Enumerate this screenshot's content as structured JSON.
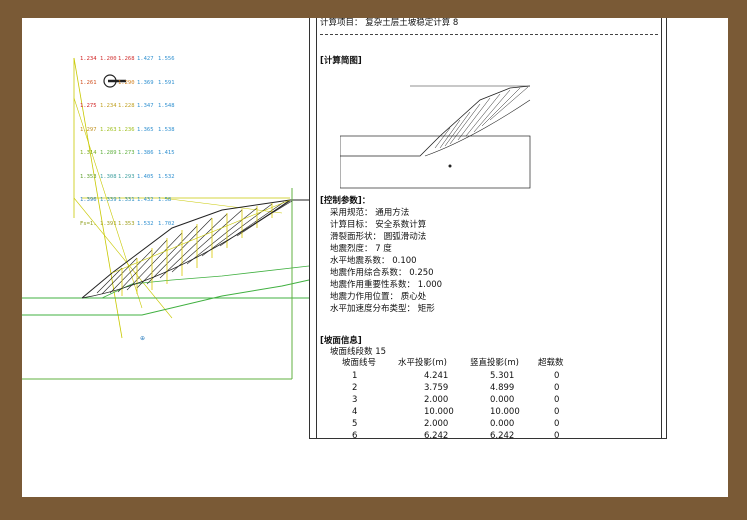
{
  "report": {
    "project_title": "计算项目：  复杂土层土坡稳定计算  8",
    "section_diagram": "[计算简图]",
    "section_control": "[控制参数]：",
    "params": [
      "采用规范：  通用方法",
      "计算目标：  安全系数计算",
      "滑裂面形状：  圆弧滑动法",
      "地震烈度：  7 度",
      "水平地震系数：  0.100",
      "地震作用综合系数：    0.250",
      "地震作用重要性系数：  1.000",
      "地震力作用位置：  质心处",
      "水平加速度分布类型：  矩形"
    ],
    "section_slope": "[坡面信息]",
    "slope_segments": "坡面线段数  15",
    "table_headers": [
      "坡面线号",
      "水平投影(m)",
      "竖直投影(m)",
      "超载数"
    ],
    "table_rows": [
      [
        "1",
        "4.241",
        "5.301",
        "0"
      ],
      [
        "2",
        "3.759",
        "4.899",
        "0"
      ],
      [
        "3",
        "2.000",
        "0.000",
        "0"
      ],
      [
        "4",
        "10.000",
        "10.000",
        "0"
      ],
      [
        "5",
        "2.000",
        "0.000",
        "0"
      ],
      [
        "6",
        "6.242",
        "6.242",
        "0"
      ]
    ]
  },
  "cad": {
    "safety_factor_rows": [
      [
        "1.234",
        "1.200",
        "1.268",
        "1.427",
        "1.556"
      ],
      [
        "1.261",
        "",
        "1.290",
        "1.369",
        "1.591"
      ],
      [
        "1.275",
        "1.234",
        "1.228",
        "1.347",
        "1.548"
      ],
      [
        "1.297",
        "1.263",
        "1.236",
        "1.365",
        "1.538"
      ],
      [
        "1.314",
        "1.289",
        "1.273",
        "1.386",
        "1.415"
      ],
      [
        "1.353",
        "1.308",
        "1.293",
        "1.405",
        "1.532"
      ],
      [
        "1.396",
        "1.339",
        "1.331",
        "1.432",
        "1.58"
      ],
      [
        "Fs=1.",
        "1.391",
        "1.353",
        "1.532",
        "1.702"
      ]
    ],
    "row_colors": [
      "#d03030",
      "#d08020",
      "#c0a020",
      "#a0c020",
      "#60b040",
      "#40a0a0",
      "#3090c0",
      "#a0a020"
    ],
    "grid_value_color": "#3090d0",
    "first_col_colors": [
      "#d02020",
      "#d05020",
      "#d02020",
      "#c09020",
      "#80b020",
      "#60a030",
      "#3080c0",
      "#90a020"
    ]
  }
}
